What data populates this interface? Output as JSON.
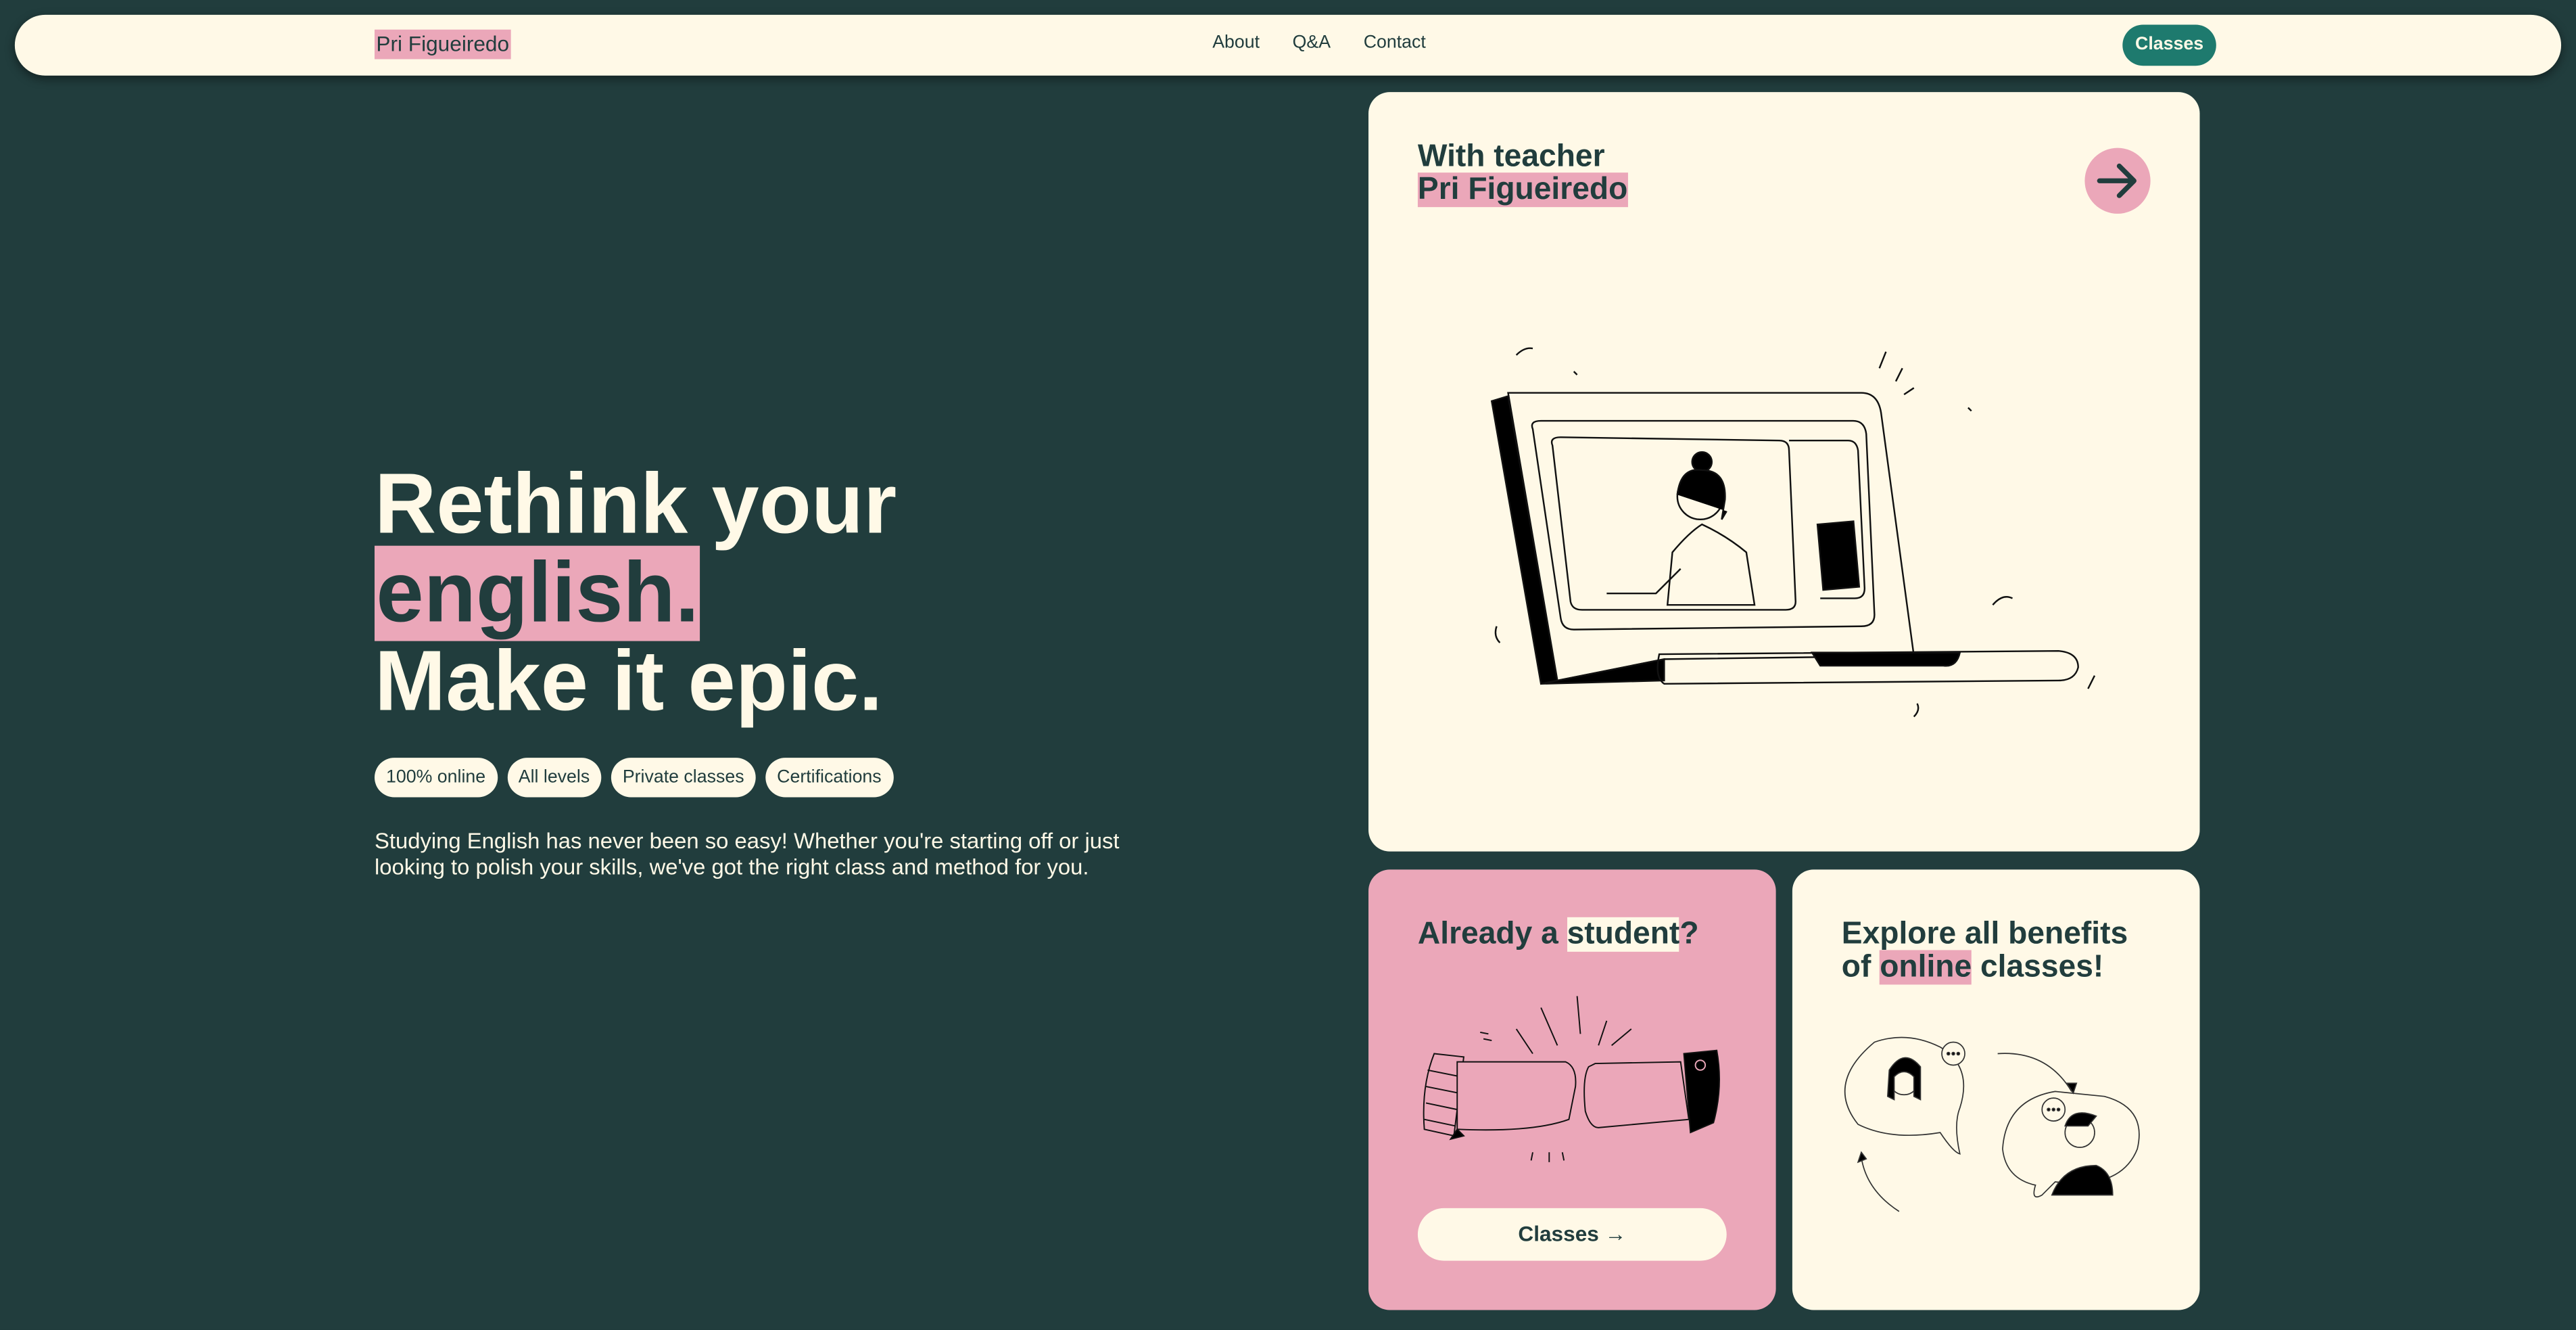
{
  "nav": {
    "logo": "Pri Figueiredo",
    "links": [
      "About",
      "Q&A",
      "Contact"
    ],
    "cta": "Classes"
  },
  "hero": {
    "line1": "Rethink your",
    "line2": "english.",
    "line3": "Make it epic.",
    "chips": [
      "100% online",
      "All levels",
      "Private classes",
      "Certifications"
    ],
    "description": "Studying English has never been so easy! Whether you're starting off or just looking to polish your skills, we've got the right class and method for you."
  },
  "teacher_card": {
    "line1": "With teacher",
    "line2": "Pri Figueiredo",
    "icon": "arrow-right-icon"
  },
  "student_card": {
    "prefix": "Already a ",
    "highlight": "student",
    "suffix": "?",
    "button": "Classes →"
  },
  "benefits_card": {
    "line1": "Explore all benefits",
    "prefix": "of ",
    "highlight": "online",
    "suffix": " classes!"
  },
  "colors": {
    "background": "#213d3d",
    "cream": "#fff9e7",
    "pink": "#eba7b9",
    "teal": "#1e7a6e"
  }
}
